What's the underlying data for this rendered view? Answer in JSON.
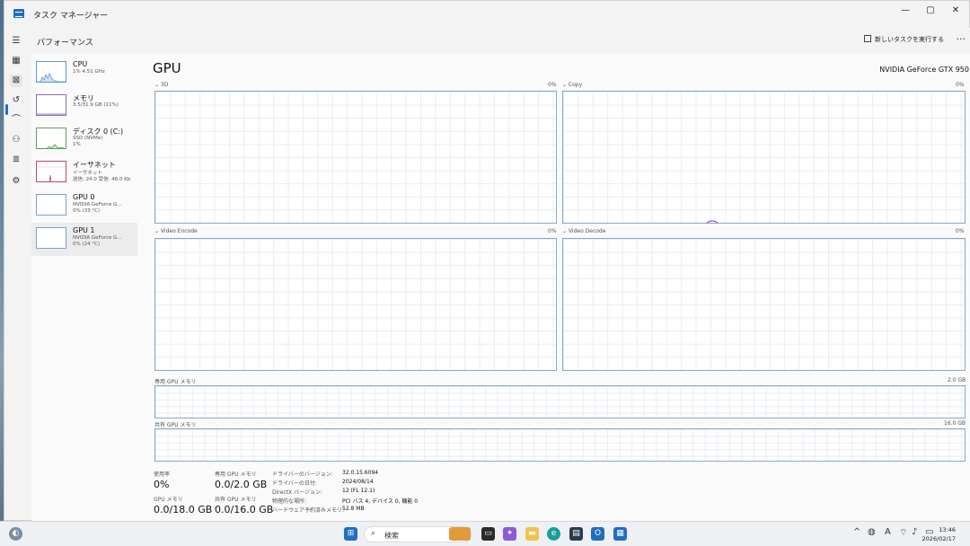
{
  "window": {
    "title": "タスク マネージャー",
    "minimize": "—",
    "maximize": "▢",
    "close": "✕"
  },
  "header": {
    "page_title": "パフォーマンス",
    "new_task": "新しいタスクを実行する",
    "more": "···"
  },
  "devices": [
    {
      "name": "CPU",
      "sub1": "1% 4.51 GHz",
      "sub2": ""
    },
    {
      "name": "メモリ",
      "sub1": "3.5/31.9 GB (11%)",
      "sub2": ""
    },
    {
      "name": "ディスク 0 (C:)",
      "sub1": "SSD (NVMe)",
      "sub2": "1%"
    },
    {
      "name": "イーサネット",
      "sub1": "イーサネット",
      "sub2": "送信: 24.0 受信: 48.0 Kb"
    },
    {
      "name": "GPU 0",
      "sub1": "NVIDIA GeForce G...",
      "sub2": "0% (33 °C)"
    },
    {
      "name": "GPU 1",
      "sub1": "NVIDIA GeForce G...",
      "sub2": "0% (24 °C)"
    }
  ],
  "gpu": {
    "title": "GPU",
    "model": "NVIDIA GeForce GTX 950",
    "graphs": [
      {
        "label": "⌄ 3D",
        "pct": "0%"
      },
      {
        "label": "⌄ Copy",
        "pct": "0%"
      },
      {
        "label": "⌄ Video Encode",
        "pct": "0%"
      },
      {
        "label": "⌄ Video Decode",
        "pct": "0%"
      }
    ],
    "dedicated": {
      "label": "専用 GPU メモリ",
      "max": "2.0 GB"
    },
    "shared": {
      "label": "共有 GPU メモリ",
      "max": "16.0 GB"
    }
  },
  "stats": {
    "usage_label": "使用率",
    "usage": "0%",
    "gpu_mem_label": "GPU メモリ",
    "gpu_mem": "0.0/18.0 GB",
    "ded_label": "専用 GPU メモリ",
    "ded": "0.0/2.0 GB",
    "shared_label": "共有 GPU メモリ",
    "shared": "0.0/16.0 GB",
    "info": [
      {
        "k": "ドライバーのバージョン:",
        "v": "32.0.15.6094"
      },
      {
        "k": "ドライバーの日付:",
        "v": "2024/08/14"
      },
      {
        "k": "DirectX バージョン:",
        "v": "12 (FL 12.1)"
      },
      {
        "k": "物理的な場所:",
        "v": "PCI バス 4, デバイス 0, 機能 0"
      },
      {
        "k": "ハードウェア予約済みメモリ:",
        "v": "52.8 MB"
      }
    ]
  },
  "taskbar": {
    "search": "検索",
    "time": "13:46",
    "date": "2026/02/17",
    "ime": "A"
  },
  "colors": {
    "accent": "#1f6fc0",
    "graph_border": "#8aa8c4"
  }
}
